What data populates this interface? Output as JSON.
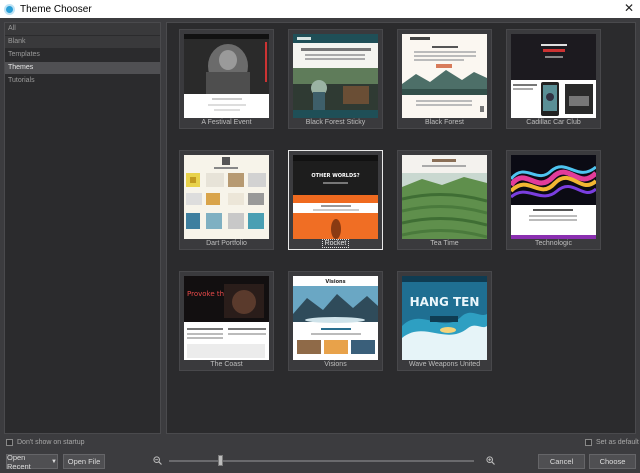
{
  "window": {
    "title": "Theme Chooser",
    "close_glyph": "✕"
  },
  "sidebar": {
    "items": [
      {
        "label": "All"
      },
      {
        "label": "Blank"
      },
      {
        "label": "Templates"
      },
      {
        "label": "Themes",
        "selected": true
      },
      {
        "label": "Tutorials"
      }
    ]
  },
  "themes": [
    {
      "name": "A Festival Event",
      "thumb_text": ""
    },
    {
      "name": "Black Forest Sticky",
      "thumb_text": ""
    },
    {
      "name": "Black Forest",
      "thumb_text": ""
    },
    {
      "name": "Cadillac Car Club",
      "thumb_text": ""
    },
    {
      "name": "Dart Portfolio",
      "thumb_text": ""
    },
    {
      "name": "Rocket",
      "thumb_text": "OTHER WORLDS?",
      "selected": true
    },
    {
      "name": "Tea Time",
      "thumb_text": ""
    },
    {
      "name": "Technologic",
      "thumb_text": ""
    },
    {
      "name": "The Coast",
      "thumb_text": "Provoke those buds"
    },
    {
      "name": "Visions",
      "thumb_text": "Visions"
    },
    {
      "name": "Wave Weapons United",
      "thumb_text": "HANG TEN"
    }
  ],
  "footer": {
    "dont_show_label": "Don't show on startup",
    "set_default_label": "Set as default",
    "open_recent_label": "Open Recent",
    "open_file_label": "Open File",
    "cancel_label": "Cancel",
    "choose_label": "Choose",
    "zoom_level": 0.17
  },
  "colors": {
    "accent": "#2a9fd6",
    "background": "#3c3c3f",
    "panel": "#2b2b2d"
  }
}
